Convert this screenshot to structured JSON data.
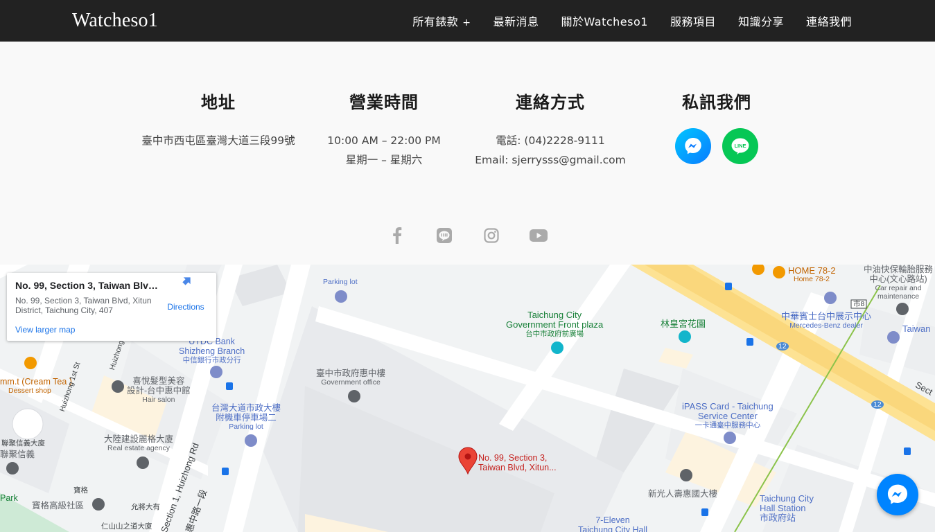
{
  "header": {
    "logo": "Watcheso1",
    "nav": [
      {
        "label": "所有錶款",
        "suffix": "+"
      },
      {
        "label": "最新消息"
      },
      {
        "label": "關於Watcheso1"
      },
      {
        "label": "服務項目"
      },
      {
        "label": "知識分享"
      },
      {
        "label": "連絡我們"
      }
    ]
  },
  "info": {
    "address": {
      "title": "地址",
      "line1": "臺中市西屯區臺灣大道三段99號"
    },
    "hours": {
      "title": "營業時間",
      "line1": "10:00 AM – 22:00 PM",
      "line2": "星期一 – 星期六"
    },
    "contact": {
      "title": "連絡方式",
      "line1": "電話: (04)2228-9111",
      "line2": "Email: sjerrysss@gmail.com"
    },
    "message": {
      "title": "私訊我們",
      "icons": [
        "messenger-icon",
        "line-icon"
      ]
    }
  },
  "social": [
    "facebook-icon",
    "line-icon",
    "instagram-icon",
    "youtube-icon"
  ],
  "map": {
    "card": {
      "title": "No. 99, Section 3, Taiwan Blvd...",
      "address": "No. 99, Section 3, Taiwan Blvd, Xitun District, Taichung City, 407",
      "directions": "Directions",
      "larger_map": "View larger map"
    },
    "pin_label_1": "No. 99, Section 3,",
    "pin_label_2": "Taiwan Blvd, Xitun...",
    "labels": {
      "parking1": "Parking lot",
      "plaza_en1": "Taichung City",
      "plaza_en2": "Government Front plaza",
      "plaza_zh": "台中市政府前廣場",
      "lin": "林皇宮花園",
      "home_en": "HOME 78-2",
      "home_sub": "Home 78-2",
      "car_zh1": "中油快保輪胎服務",
      "car_zh2": "中心(文心路站)",
      "car_en1": "Car repair and",
      "car_en2": "maintenance",
      "benz_zh": "中華賓士台中展示中心",
      "benz_en": "Mercedes-Benz dealer",
      "taiwan": "Taiwan",
      "city8": "市8",
      "sect": "Sect",
      "r12a": "12",
      "r12b": "12",
      "cream": "mm.t (Cream Tea )",
      "cream_sub": "Dessert shop",
      "utdc_en1": "UTDC Bank",
      "utdc_en2": "Shizheng Branch",
      "utdc_zh": "中信銀行市政分行",
      "gov_zh": "臺中市政府惠中樓",
      "gov_en": "Government office",
      "hair_zh1": "喜悅髮型美容",
      "hair_zh2": "設計-台中惠中館",
      "hair_en": "Hair salon",
      "huizhong1st": "Huizhong 1st St",
      "huizhong": "Huizhong",
      "park2_zh1": "台灣大道市政大樓",
      "park2_zh2": "附機車停車場二",
      "park2_en": "Parking lot",
      "ipass_en1": "iPASS Card - Taichung",
      "ipass_en2": "Service Center",
      "ipass_zh": "一卡通臺中服務中心",
      "dalu_zh": "大陸建設麗格大廈",
      "dalu_en": "Real estate agency",
      "lianju": "聯聚信義大廈",
      "lianju2": "聯聚信義",
      "baoge": "寶格",
      "baoge2": "寶格高級社區",
      "yunfang": "允將大有",
      "renshan": "仁山山之道大廈",
      "park": "Park",
      "xinguang": "新光人壽惠國大樓",
      "seveneleven1": "7-Eleven",
      "seveneleven2": "Taichung City Hall",
      "station_en1": "Taichung City",
      "station_en2": "Hall Station",
      "station_zh": "市政府站",
      "huizhongrd": "Section 1, Huizhong Rd",
      "huizhongrd_zh": "惠中路一段"
    }
  },
  "colors": {
    "header_bg": "#222222",
    "messenger": "#0a7cff",
    "line": "#06c755",
    "social_icon": "#aaaaaa"
  }
}
